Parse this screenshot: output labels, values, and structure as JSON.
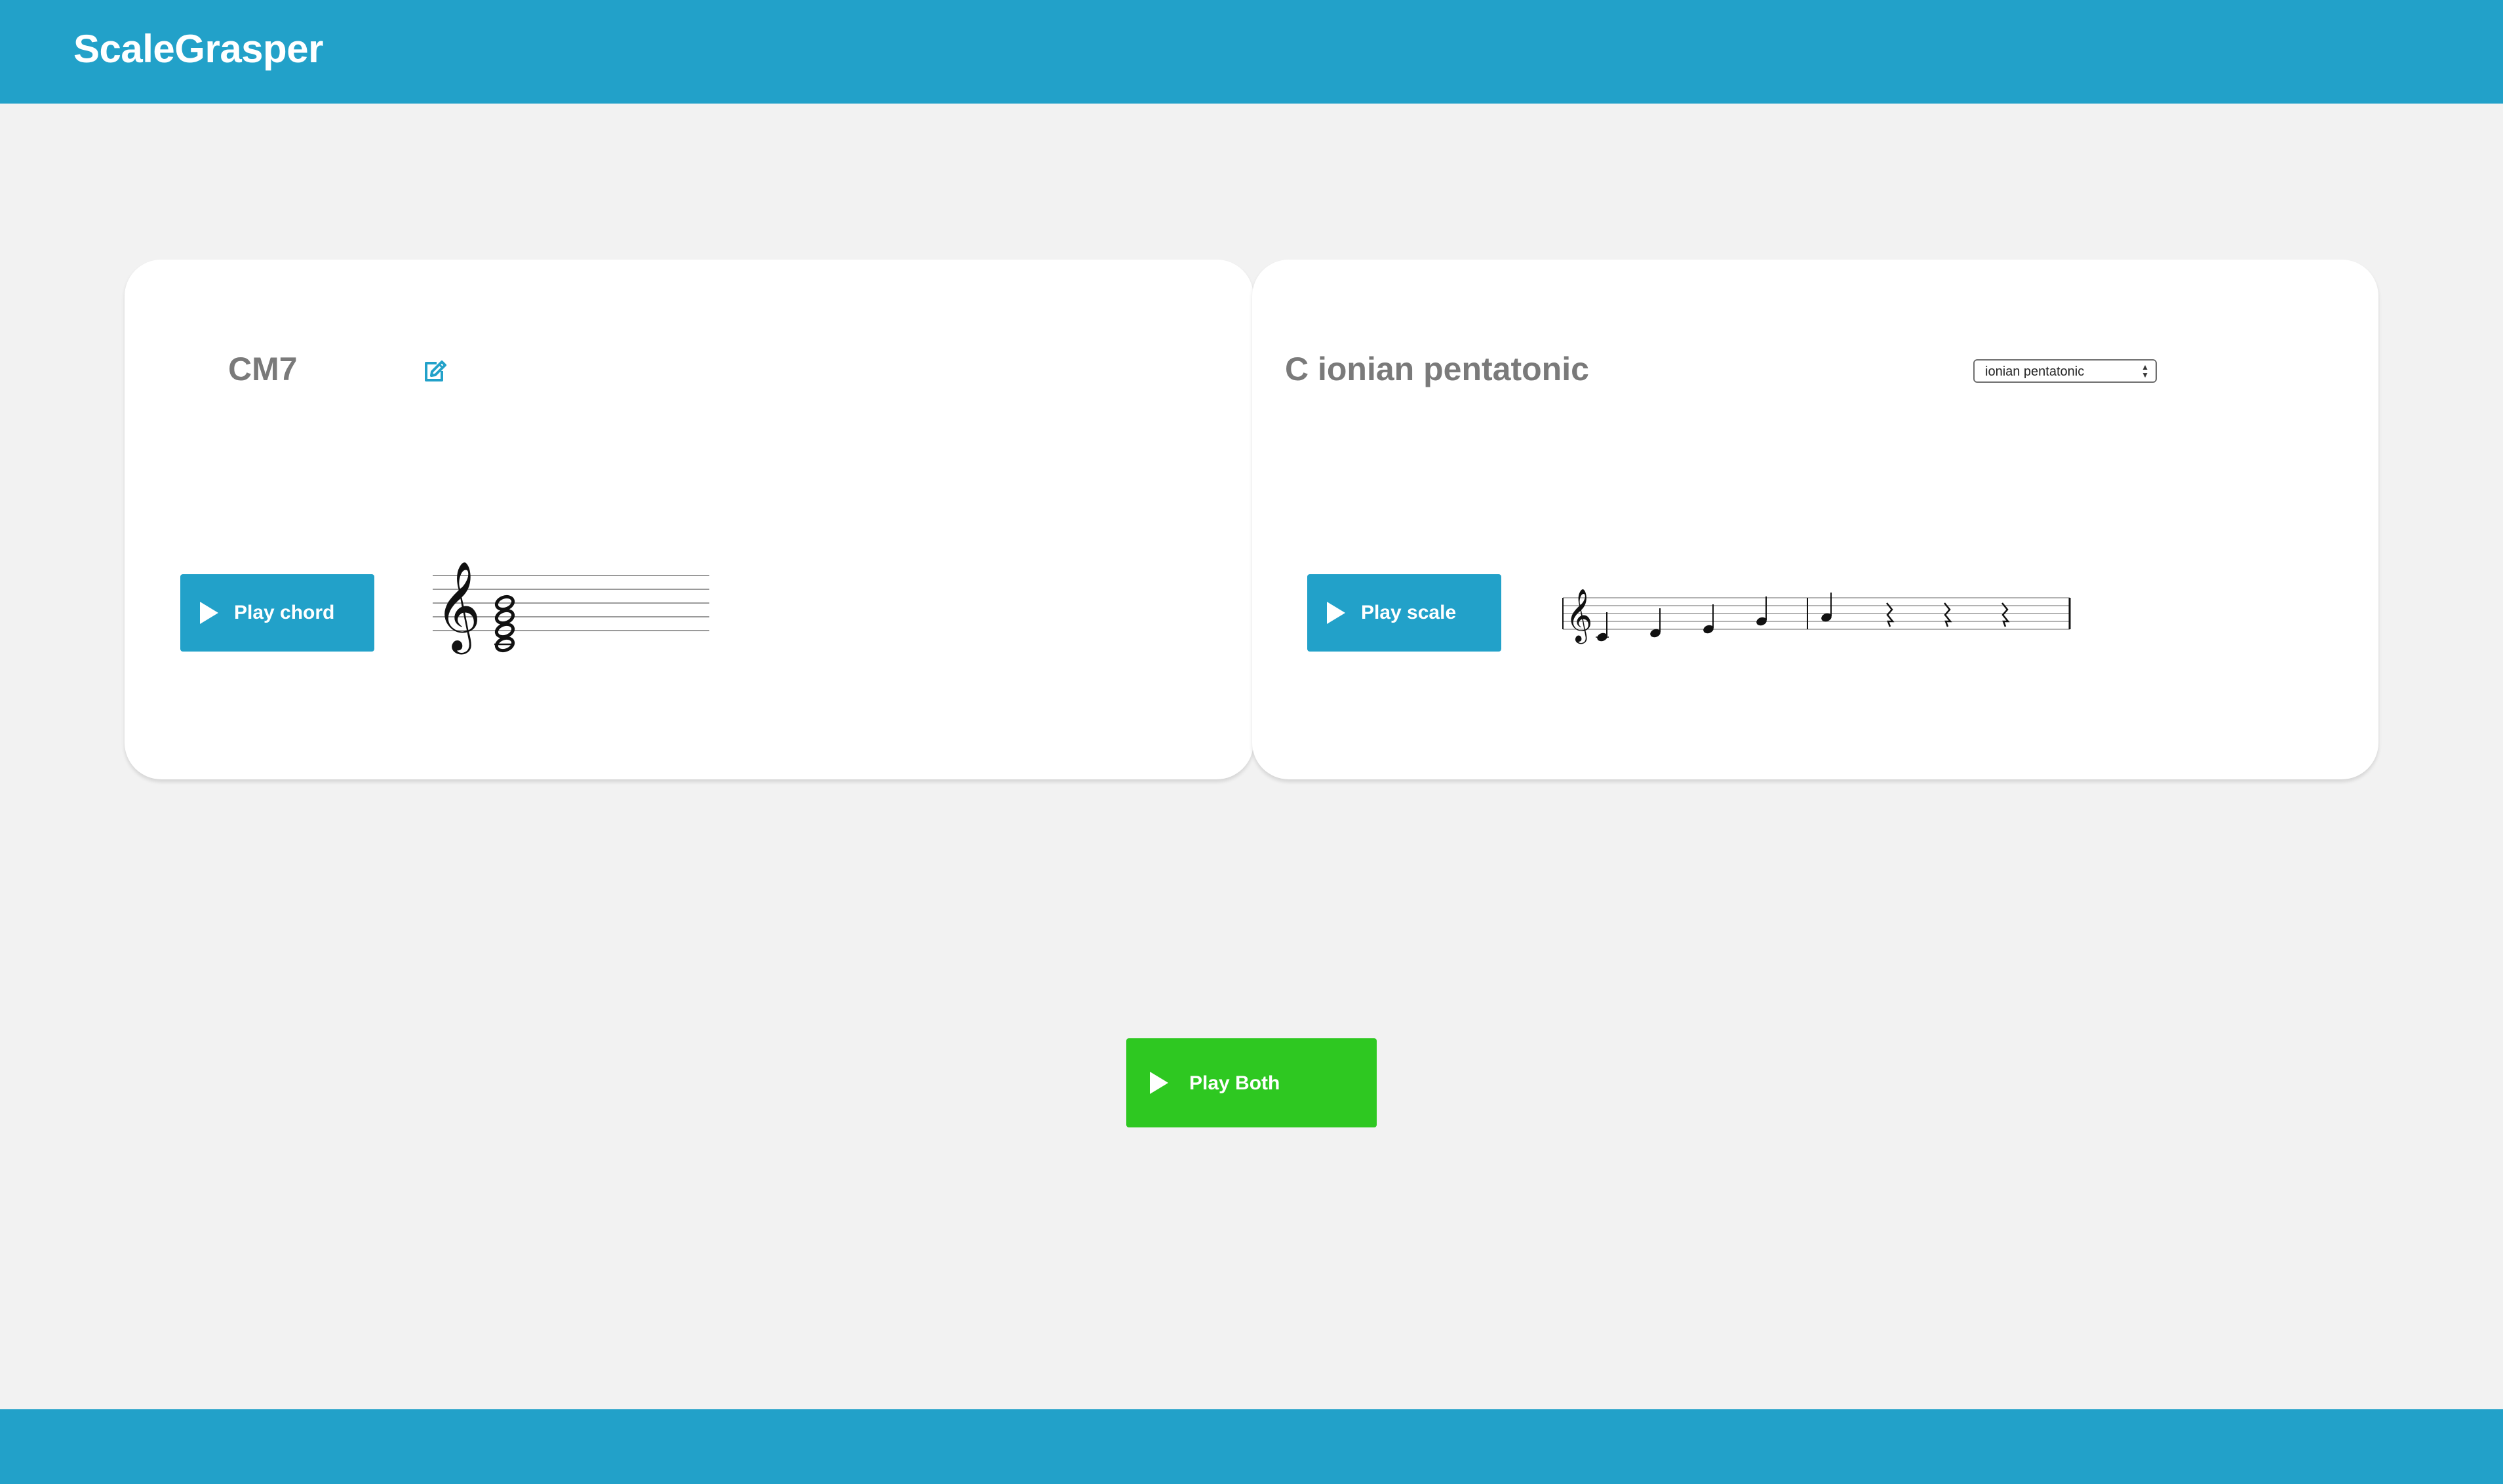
{
  "app": {
    "title": "ScaleGrasper"
  },
  "chord_card": {
    "title": "CM7",
    "edit_icon": "edit-icon",
    "play_label": "Play chord",
    "play_icon": "play-icon",
    "notation": {
      "clef": "treble",
      "chord_notes": [
        "C4",
        "E4",
        "G4",
        "B4"
      ]
    }
  },
  "scale_card": {
    "title": "C ionian pentatonic",
    "scale_select": {
      "selected": "ionian pentatonic"
    },
    "play_label": "Play scale",
    "play_icon": "play-icon",
    "notation": {
      "clef": "treble",
      "measures": [
        [
          "C4",
          "D4",
          "E4",
          "G4"
        ],
        [
          "A4",
          "rest",
          "rest",
          "rest"
        ]
      ]
    }
  },
  "play_both": {
    "label": "Play Both",
    "icon": "play-icon",
    "color": "#2ec821"
  },
  "colors": {
    "primary": "#22a1c9",
    "background": "#f2f2f2",
    "card": "#ffffff",
    "title_text": "#7a7a7a",
    "play_both": "#2ec821"
  }
}
